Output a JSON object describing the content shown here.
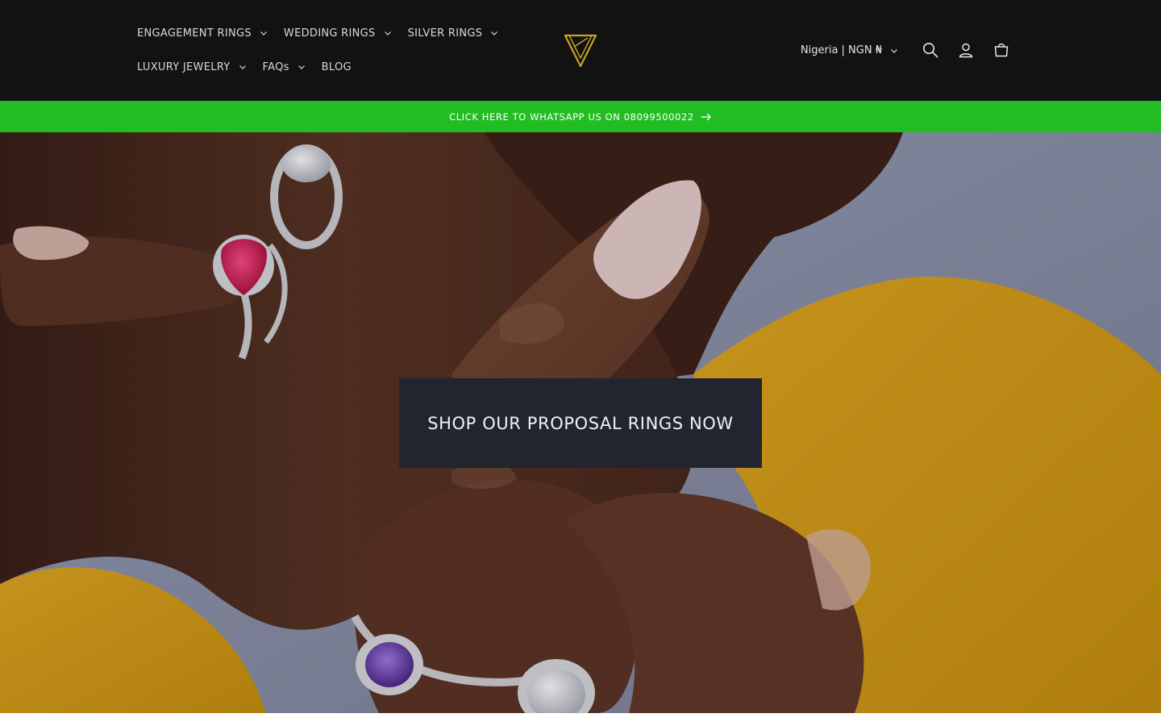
{
  "header": {
    "nav_row_1": [
      {
        "label": "ENGAGEMENT RINGS",
        "has_dropdown": true
      },
      {
        "label": "WEDDING RINGS",
        "has_dropdown": true
      },
      {
        "label": "SILVER RINGS",
        "has_dropdown": true
      }
    ],
    "nav_row_2": [
      {
        "label": "LUXURY JEWELRY",
        "has_dropdown": true
      },
      {
        "label": "FAQs",
        "has_dropdown": true
      },
      {
        "label": "BLOG",
        "has_dropdown": false
      }
    ],
    "logo_icon": "diamond-logo-icon",
    "locale_label": "Nigeria | NGN ₦",
    "icons": {
      "search": "search-icon",
      "account": "account-icon",
      "cart": "cart-icon"
    }
  },
  "announcement": {
    "text": "CLICK HERE TO WHATSAPP US ON 08099500022",
    "icon": "arrow-right-icon"
  },
  "hero": {
    "cta_label": "SHOP OUR PROPOSAL RINGS NOW",
    "image_subject": "hands-with-gemstone-rings"
  },
  "colors": {
    "header_bg": "#121212",
    "announcement_bg": "#22bd22",
    "cta_bg": "#22252f",
    "logo_gold": "#c9a227"
  }
}
